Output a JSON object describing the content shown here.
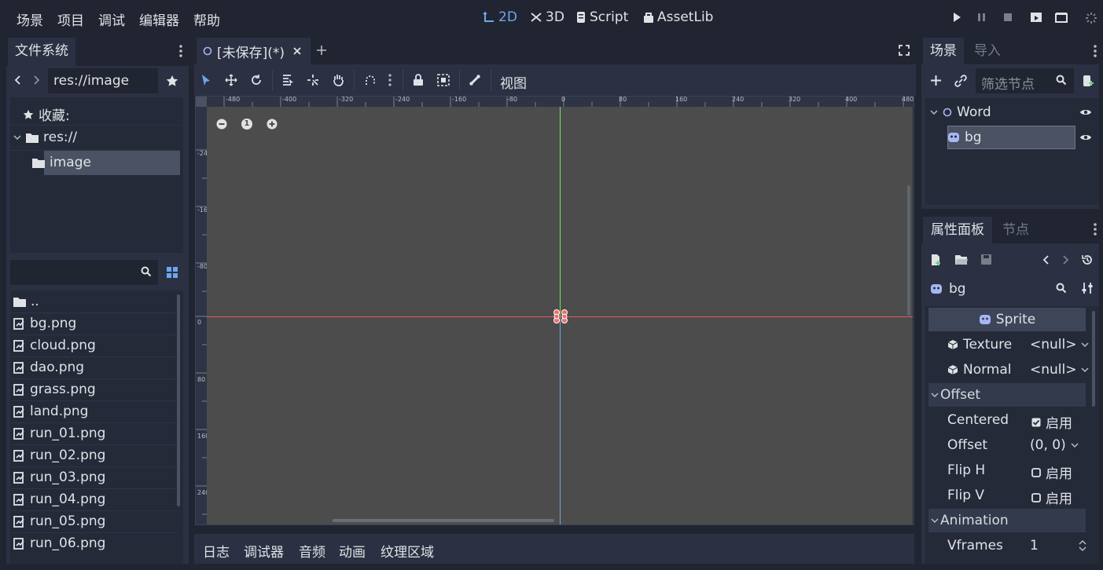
{
  "menu": [
    "场景",
    "项目",
    "调试",
    "编辑器",
    "帮助"
  ],
  "workspaces": {
    "tab_2d": "2D",
    "tab_3d": "3D",
    "tab_script": "Script",
    "tab_assetlib": "AssetLib",
    "active": "2D"
  },
  "filesystem": {
    "tab_label": "文件系统",
    "path_value": "res://image",
    "favorites_label": "收藏:",
    "tree": {
      "root": "res://",
      "selected_folder": "image"
    },
    "search_placeholder": "",
    "files": [
      "..",
      "bg.png",
      "cloud.png",
      "dao.png",
      "grass.png",
      "land.png",
      "run_01.png",
      "run_02.png",
      "run_03.png",
      "run_04.png",
      "run_05.png",
      "run_06.png"
    ]
  },
  "editor": {
    "scene_tab_label": "[未保存](*)",
    "view_menu": "视图",
    "zoom_reset": "1",
    "ruler_h": [
      "-480",
      "-400",
      "-320",
      "-240",
      "-160",
      "-80",
      "0",
      "80",
      "160",
      "240",
      "320",
      "400",
      "480"
    ],
    "ruler_v": [
      "-240",
      "-160",
      "-80",
      "0",
      "80",
      "160",
      "240"
    ]
  },
  "bottom_panel": {
    "tabs": [
      "日志",
      "调试器",
      "音频",
      "动画",
      "纹理区域"
    ]
  },
  "scene_dock": {
    "tab_scene": "场景",
    "tab_import": "导入",
    "filter_placeholder": "筛选节点",
    "nodes": {
      "root": "Word",
      "child": "bg"
    }
  },
  "inspector": {
    "tab_inspector": "属性面板",
    "tab_node": "节点",
    "object_name": "bg",
    "class_header": "Sprite",
    "texture_label": "Texture",
    "texture_value": "<null>",
    "normal_label": "Normal",
    "normal_value": "<null>",
    "offset_section": "Offset",
    "centered_label": "Centered",
    "centered_value": "启用",
    "centered_checked": true,
    "offset_label": "Offset",
    "offset_value": "(0, 0)",
    "flip_h_label": "Flip H",
    "flip_h_value": "启用",
    "flip_v_label": "Flip V",
    "flip_v_value": "启用",
    "animation_section": "Animation",
    "vframes_label": "Vframes",
    "vframes_value": "1"
  },
  "colors": {
    "accent": "#6ea6ee",
    "background": "#202531",
    "panel": "#2b3142",
    "viewport": "#4c4c4c",
    "axis_x": "#e05a5a",
    "axis_y": "#7ee05a",
    "axis_y_lower": "#6aa8e0"
  }
}
